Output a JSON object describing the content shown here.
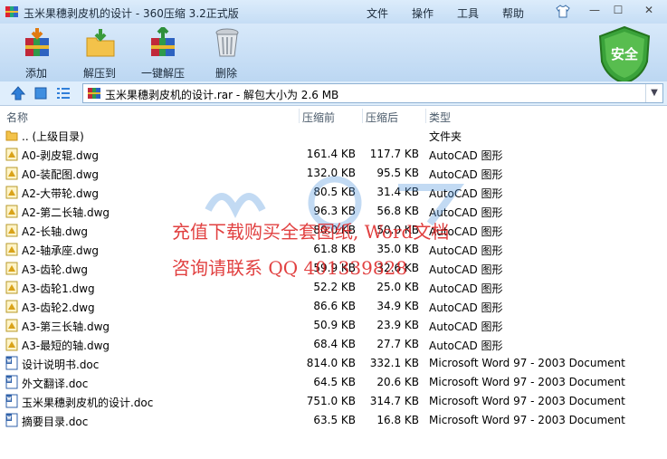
{
  "window": {
    "title": "玉米果穗剥皮机的设计 - 360压缩 3.2正式版",
    "menu": [
      "文件",
      "操作",
      "工具",
      "帮助"
    ],
    "controls": {
      "minimize": "—",
      "maximize": "☐",
      "close": "✕"
    }
  },
  "toolbar": {
    "buttons": [
      {
        "label": "添加",
        "icon": "add-archive-icon"
      },
      {
        "label": "解压到",
        "icon": "extract-folder-icon"
      },
      {
        "label": "一键解压",
        "icon": "one-click-extract-icon"
      },
      {
        "label": "删除",
        "icon": "trash-bin-icon"
      }
    ],
    "security_badge": "安全"
  },
  "address": {
    "text": "玉米果穗剥皮机的设计.rar - 解包大小为 2.6 MB"
  },
  "columns": {
    "name": "名称",
    "size": "压缩前",
    "packed": "压缩后",
    "type": "类型"
  },
  "files": [
    {
      "name": ".. (上级目录)",
      "size": "",
      "packed": "",
      "type": "文件夹",
      "icon": "folder-icon"
    },
    {
      "name": "A0-剥皮辊.dwg",
      "size": "161.4 KB",
      "packed": "117.7 KB",
      "type": "AutoCAD 图形",
      "icon": "dwg-icon"
    },
    {
      "name": "A0-装配图.dwg",
      "size": "132.0 KB",
      "packed": "95.5 KB",
      "type": "AutoCAD 图形",
      "icon": "dwg-icon"
    },
    {
      "name": "A2-大带轮.dwg",
      "size": "80.5 KB",
      "packed": "31.4 KB",
      "type": "AutoCAD 图形",
      "icon": "dwg-icon"
    },
    {
      "name": "A2-第二长轴.dwg",
      "size": "96.3 KB",
      "packed": "56.8 KB",
      "type": "AutoCAD 图形",
      "icon": "dwg-icon"
    },
    {
      "name": "A2-长轴.dwg",
      "size": "80.0 KB",
      "packed": "50.0 KB",
      "type": "AutoCAD 图形",
      "icon": "dwg-icon"
    },
    {
      "name": "A2-轴承座.dwg",
      "size": "61.8 KB",
      "packed": "35.0 KB",
      "type": "AutoCAD 图形",
      "icon": "dwg-icon"
    },
    {
      "name": "A3-齿轮.dwg",
      "size": "59.9 KB",
      "packed": "32.6 KB",
      "type": "AutoCAD 图形",
      "icon": "dwg-icon"
    },
    {
      "name": "A3-齿轮1.dwg",
      "size": "52.2 KB",
      "packed": "25.0 KB",
      "type": "AutoCAD 图形",
      "icon": "dwg-icon"
    },
    {
      "name": "A3-齿轮2.dwg",
      "size": "86.6 KB",
      "packed": "34.9 KB",
      "type": "AutoCAD 图形",
      "icon": "dwg-icon"
    },
    {
      "name": "A3-第三长轴.dwg",
      "size": "50.9 KB",
      "packed": "23.9 KB",
      "type": "AutoCAD 图形",
      "icon": "dwg-icon"
    },
    {
      "name": "A3-最短的轴.dwg",
      "size": "68.4 KB",
      "packed": "27.7 KB",
      "type": "AutoCAD 图形",
      "icon": "dwg-icon"
    },
    {
      "name": "设计说明书.doc",
      "size": "814.0 KB",
      "packed": "332.1 KB",
      "type": "Microsoft Word 97 - 2003 Document",
      "icon": "word-doc-icon"
    },
    {
      "name": "外文翻译.doc",
      "size": "64.5 KB",
      "packed": "20.6 KB",
      "type": "Microsoft Word 97 - 2003 Document",
      "icon": "word-doc-icon"
    },
    {
      "name": "玉米果穗剥皮机的设计.doc",
      "size": "751.0 KB",
      "packed": "314.7 KB",
      "type": "Microsoft Word 97 - 2003 Document",
      "icon": "word-doc-icon"
    },
    {
      "name": "摘要目录.doc",
      "size": "63.5 KB",
      "packed": "16.8 KB",
      "type": "Microsoft Word 97 - 2003 Document",
      "icon": "word-doc-icon"
    }
  ],
  "watermark": {
    "line1": "充值下载购买全套图纸, Word文档",
    "line2": "咨询请联系  QQ 401339828"
  },
  "colors": {
    "accent_blue": "#2a6fc9",
    "shield_green": "#3aa23a",
    "watermark_red": "#dc1e1e"
  }
}
